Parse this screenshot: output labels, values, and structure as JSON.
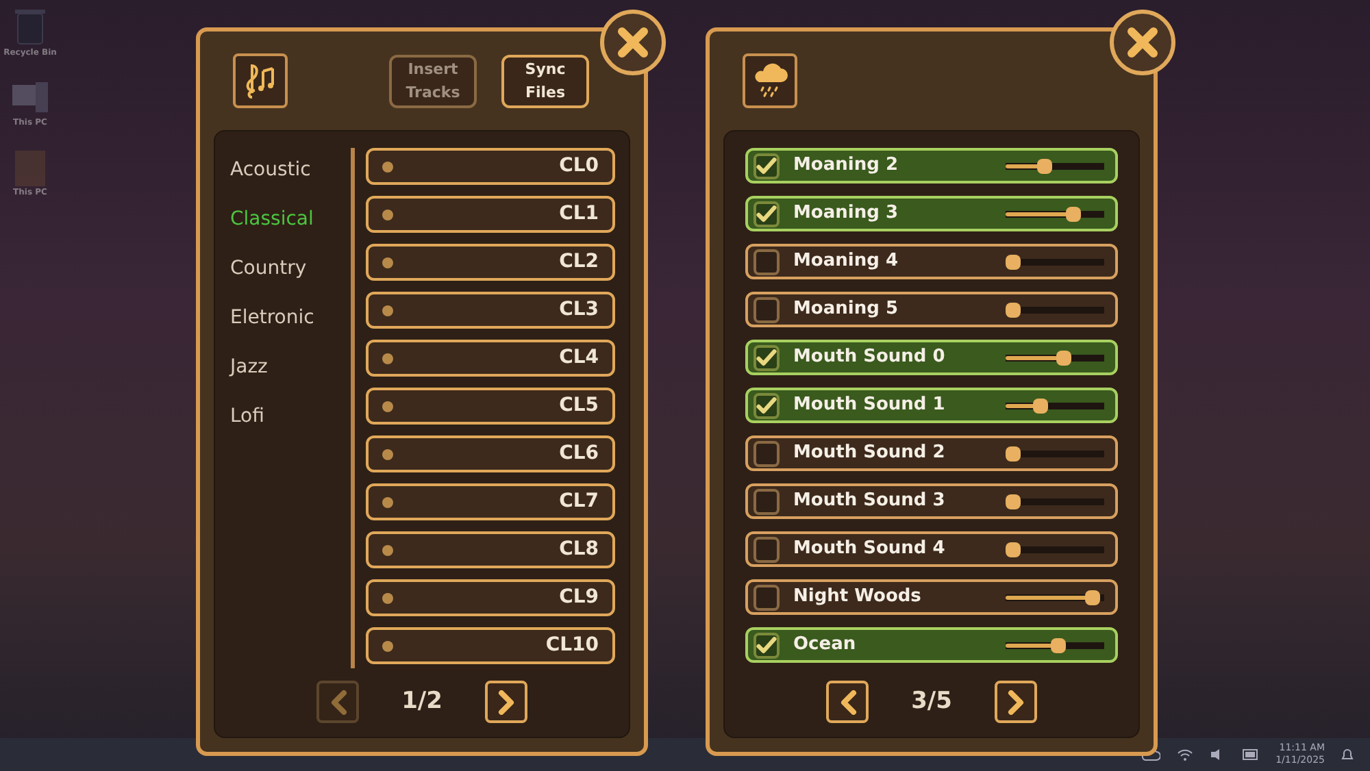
{
  "desktop_icons": [
    {
      "label": "Recycle Bin",
      "kind": "bin"
    },
    {
      "label": "This PC",
      "kind": "pc"
    },
    {
      "label": "This PC",
      "kind": "photo"
    }
  ],
  "music_panel": {
    "buttons": [
      {
        "label_lines": [
          "Insert",
          "Tracks"
        ],
        "disabled": true
      },
      {
        "label_lines": [
          "Sync",
          "Files"
        ],
        "disabled": false
      }
    ],
    "categories": [
      {
        "label": "Acoustic",
        "selected": false
      },
      {
        "label": "Classical",
        "selected": true
      },
      {
        "label": "Country",
        "selected": false
      },
      {
        "label": "Eletronic",
        "selected": false
      },
      {
        "label": "Jazz",
        "selected": false
      },
      {
        "label": "Lofi",
        "selected": false
      }
    ],
    "tracks": [
      "CL0",
      "CL1",
      "CL2",
      "CL3",
      "CL4",
      "CL5",
      "CL6",
      "CL7",
      "CL8",
      "CL9",
      "CL10"
    ],
    "pager": {
      "page": "1/2",
      "prev_disabled": true,
      "next_disabled": false
    }
  },
  "sounds_panel": {
    "sounds": [
      {
        "name": "Moaning 2",
        "checked": true,
        "level": 0.38
      },
      {
        "name": "Moaning 3",
        "checked": true,
        "level": 0.72
      },
      {
        "name": "Moaning 4",
        "checked": false,
        "level": 0
      },
      {
        "name": "Moaning 5",
        "checked": false,
        "level": 0
      },
      {
        "name": "Mouth Sound 0",
        "checked": true,
        "level": 0.6
      },
      {
        "name": "Mouth Sound 1",
        "checked": true,
        "level": 0.33
      },
      {
        "name": "Mouth Sound 2",
        "checked": false,
        "level": 0
      },
      {
        "name": "Mouth Sound 3",
        "checked": false,
        "level": 0
      },
      {
        "name": "Mouth Sound 4",
        "checked": false,
        "level": 0
      },
      {
        "name": "Night Woods",
        "checked": false,
        "level": 0.95
      },
      {
        "name": "Ocean",
        "checked": true,
        "level": 0.54
      }
    ],
    "pager": {
      "page": "3/5",
      "prev_disabled": false,
      "next_disabled": false
    }
  },
  "taskbar": {
    "time": "11:11 AM",
    "date": "1/11/2025"
  }
}
